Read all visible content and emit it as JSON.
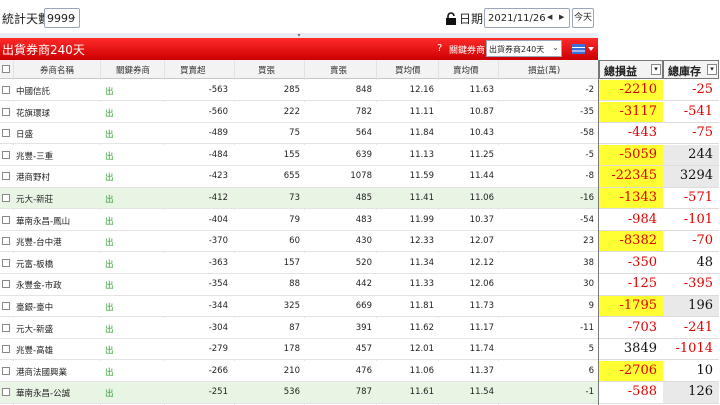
{
  "toolbar": {
    "days_label": "統計天數",
    "days_value": "9999",
    "date_label": "日期",
    "date_value": "2021/11/26",
    "today_label": "今天"
  },
  "panel": {
    "title": "出貨券商240天",
    "help": "?",
    "filter_label": "關鍵券商",
    "filter_value": "出貨券商240天",
    "header_bg": "#e60000"
  },
  "table": {
    "headers": [
      "券商名稱",
      "關鍵券商",
      "買賣超",
      "買張",
      "賣張",
      "買均價",
      "賣均價",
      "損益(萬)"
    ],
    "rows": [
      {
        "name": "中國信託",
        "key": "出",
        "net": "-563",
        "buy": "285",
        "sell": "848",
        "buy_avg": "12.16",
        "sell_avg": "11.63",
        "pl": "-2",
        "hl": false
      },
      {
        "name": "花旗環球",
        "key": "出",
        "net": "-560",
        "buy": "222",
        "sell": "782",
        "buy_avg": "11.11",
        "sell_avg": "10.87",
        "pl": "-35",
        "hl": false
      },
      {
        "name": "日盛",
        "key": "出",
        "net": "-489",
        "buy": "75",
        "sell": "564",
        "buy_avg": "11.84",
        "sell_avg": "10.43",
        "pl": "-58",
        "hl": false
      },
      {
        "name": "兆豐-三重",
        "key": "出",
        "net": "-484",
        "buy": "155",
        "sell": "639",
        "buy_avg": "11.13",
        "sell_avg": "11.25",
        "pl": "-5",
        "hl": false
      },
      {
        "name": "港商野村",
        "key": "出",
        "net": "-423",
        "buy": "655",
        "sell": "1078",
        "buy_avg": "11.59",
        "sell_avg": "11.44",
        "pl": "-8",
        "hl": false
      },
      {
        "name": "元大-新莊",
        "key": "出",
        "net": "-412",
        "buy": "73",
        "sell": "485",
        "buy_avg": "11.41",
        "sell_avg": "11.06",
        "pl": "-16",
        "hl": true
      },
      {
        "name": "華南永昌-鳳山",
        "key": "出",
        "net": "-404",
        "buy": "79",
        "sell": "483",
        "buy_avg": "11.99",
        "sell_avg": "10.37",
        "pl": "-54",
        "hl": false
      },
      {
        "name": "兆豐-台中港",
        "key": "出",
        "net": "-370",
        "buy": "60",
        "sell": "430",
        "buy_avg": "12.33",
        "sell_avg": "12.07",
        "pl": "23",
        "hl": false
      },
      {
        "name": "元富-板橋",
        "key": "出",
        "net": "-363",
        "buy": "157",
        "sell": "520",
        "buy_avg": "11.34",
        "sell_avg": "12.12",
        "pl": "38",
        "hl": false
      },
      {
        "name": "永豐金-市政",
        "key": "出",
        "net": "-354",
        "buy": "88",
        "sell": "442",
        "buy_avg": "11.33",
        "sell_avg": "12.06",
        "pl": "30",
        "hl": false
      },
      {
        "name": "臺銀-臺中",
        "key": "出",
        "net": "-344",
        "buy": "325",
        "sell": "669",
        "buy_avg": "11.81",
        "sell_avg": "11.73",
        "pl": "9",
        "hl": false
      },
      {
        "name": "元大-新盛",
        "key": "出",
        "net": "-304",
        "buy": "87",
        "sell": "391",
        "buy_avg": "11.62",
        "sell_avg": "11.17",
        "pl": "-11",
        "hl": false
      },
      {
        "name": "兆豐-高雄",
        "key": "出",
        "net": "-279",
        "buy": "178",
        "sell": "457",
        "buy_avg": "12.01",
        "sell_avg": "11.74",
        "pl": "5",
        "hl": false
      },
      {
        "name": "港商法國興業",
        "key": "出",
        "net": "-266",
        "buy": "210",
        "sell": "476",
        "buy_avg": "11.06",
        "sell_avg": "11.37",
        "pl": "6",
        "hl": false
      },
      {
        "name": "華南永昌-公誠",
        "key": "出",
        "net": "-251",
        "buy": "536",
        "sell": "787",
        "buy_avg": "11.61",
        "sell_avg": "11.54",
        "pl": "-1",
        "hl": true
      }
    ]
  },
  "summary": {
    "headers": [
      "總損益",
      "總庫存"
    ],
    "rows": [
      {
        "pl": "-2210",
        "pl_yellow": true,
        "pl_red": true,
        "inv": "-25",
        "inv_red": true,
        "inv_gray": false
      },
      {
        "pl": "-3117",
        "pl_yellow": true,
        "pl_red": true,
        "inv": "-541",
        "inv_red": true,
        "inv_gray": false
      },
      {
        "pl": "-443",
        "pl_yellow": false,
        "pl_red": true,
        "inv": "-75",
        "inv_red": true,
        "inv_gray": false
      },
      {
        "pl": "-5059",
        "pl_yellow": true,
        "pl_red": true,
        "inv": "244",
        "inv_red": false,
        "inv_gray": true
      },
      {
        "pl": "-22345",
        "pl_yellow": true,
        "pl_red": true,
        "inv": "3294",
        "inv_red": false,
        "inv_gray": true
      },
      {
        "pl": "-1343",
        "pl_yellow": true,
        "pl_red": true,
        "inv": "-571",
        "inv_red": true,
        "inv_gray": false
      },
      {
        "pl": "-984",
        "pl_yellow": false,
        "pl_red": true,
        "inv": "-101",
        "inv_red": true,
        "inv_gray": false
      },
      {
        "pl": "-8382",
        "pl_yellow": true,
        "pl_red": true,
        "inv": "-70",
        "inv_red": true,
        "inv_gray": false
      },
      {
        "pl": "-350",
        "pl_yellow": false,
        "pl_red": true,
        "inv": "48",
        "inv_red": false,
        "inv_gray": false
      },
      {
        "pl": "-125",
        "pl_yellow": false,
        "pl_red": true,
        "inv": "-395",
        "inv_red": true,
        "inv_gray": false
      },
      {
        "pl": "-1795",
        "pl_yellow": true,
        "pl_red": true,
        "inv": "196",
        "inv_red": false,
        "inv_gray": true
      },
      {
        "pl": "-703",
        "pl_yellow": false,
        "pl_red": true,
        "inv": "-241",
        "inv_red": true,
        "inv_gray": false
      },
      {
        "pl": "3849",
        "pl_yellow": false,
        "pl_red": false,
        "inv": "-1014",
        "inv_red": true,
        "inv_gray": false
      },
      {
        "pl": "-2706",
        "pl_yellow": true,
        "pl_red": true,
        "inv": "10",
        "inv_red": false,
        "inv_gray": false
      },
      {
        "pl": "-588",
        "pl_yellow": false,
        "pl_red": true,
        "inv": "126",
        "inv_red": false,
        "inv_gray": true
      }
    ]
  },
  "colors": {
    "key_broker": "#2e9a2e",
    "loss_red": "#e00000",
    "highlight_yellow": "#ffff33",
    "row_highlight": "#e8f4e4"
  }
}
